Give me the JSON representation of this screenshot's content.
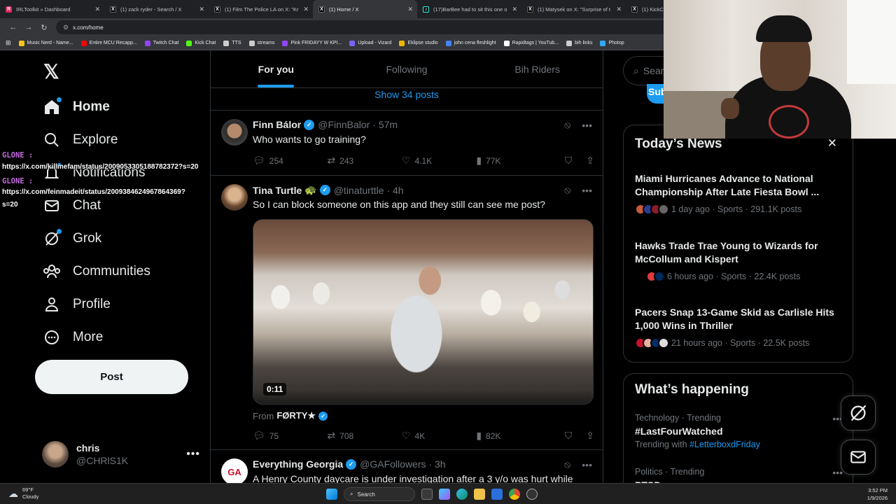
{
  "browser": {
    "tabs": [
      {
        "title": "IRLToolkit » Dashboard",
        "icon": "irltoolkit-icon",
        "active": false
      },
      {
        "title": "(1) zack ryder - Search / X",
        "icon": "x-icon",
        "active": false
      },
      {
        "title": "(1) Film The Police LA on X: \"Kr",
        "icon": "x-icon",
        "active": false
      },
      {
        "title": "(1) Home / X",
        "icon": "x-icon",
        "active": true
      },
      {
        "title": "(17)BarBee had to sit this one o",
        "icon": "tiktok-icon",
        "active": false
      },
      {
        "title": "(1) Matysek on X: \"Surprise of t",
        "icon": "x-icon",
        "active": false
      },
      {
        "title": "(1) KickC",
        "icon": "x-icon",
        "active": false
      }
    ],
    "url": "x.com/home",
    "bookmarks": [
      {
        "label": "Music Nerd - Name...",
        "color": "#f5c518"
      },
      {
        "label": "Entire MCU Recapp...",
        "color": "#ff0000"
      },
      {
        "label": "Twitch Chat",
        "color": "#9146ff"
      },
      {
        "label": "Kick Chat",
        "color": "#53fc18"
      },
      {
        "label": "TTS",
        "color": "#cccccc"
      },
      {
        "label": "streams",
        "color": "#cccccc"
      },
      {
        "label": "Pink FRIDAYY W KPI...",
        "color": "#9146ff"
      },
      {
        "label": "Upload - Vizard",
        "color": "#7b61ff"
      },
      {
        "label": "Eklipse studio",
        "color": "#f0b400"
      },
      {
        "label": "john cena fleshlight",
        "color": "#4285f4"
      },
      {
        "label": "Rapidtags | YouTub...",
        "color": "#ffffff"
      },
      {
        "label": "bih links",
        "color": "#cccccc"
      },
      {
        "label": "Photop",
        "color": "#31a8ff"
      }
    ]
  },
  "nav": {
    "items": [
      {
        "label": "Home",
        "icon": "home-icon"
      },
      {
        "label": "Explore",
        "icon": "search-icon"
      },
      {
        "label": "Notifications",
        "icon": "bell-icon"
      },
      {
        "label": "Chat",
        "icon": "mail-icon"
      },
      {
        "label": "Grok",
        "icon": "grok-icon"
      },
      {
        "label": "Communities",
        "icon": "communities-icon"
      },
      {
        "label": "Profile",
        "icon": "profile-icon"
      },
      {
        "label": "More",
        "icon": "more-circle-icon"
      }
    ],
    "post_label": "Post",
    "user": {
      "name": "chris",
      "handle": "@CHRlS1K"
    }
  },
  "chat_overlay": [
    {
      "name": "GLONE",
      "msg": "https://x.com/killmefam/status/2009053305188782372?s=20"
    },
    {
      "name": "GLONE",
      "msg_line1": "https://x.com/feinmadeit/status/2009384624967864369?",
      "msg_line2": "s=20"
    }
  ],
  "feed": {
    "tabs": [
      "For you",
      "Following",
      "Bih Riders"
    ],
    "show_posts": "Show 34 posts",
    "tweets": [
      {
        "name": "Finn Bálor",
        "handle": "@FinnBalor",
        "time": "57m",
        "text": "Who wants to go training?",
        "replies": "254",
        "reposts": "243",
        "likes": "4.1K",
        "views": "77K"
      },
      {
        "name": "Tina Turtle",
        "emoji": "🐢",
        "handle": "@tinaturttle",
        "time": "4h",
        "text": "So I can block someone on this app and they still can see me post?",
        "video_time": "0:11",
        "from_label": "From",
        "from_name": "FØRTY★",
        "replies": "75",
        "reposts": "708",
        "likes": "4K",
        "views": "82K"
      },
      {
        "name": "Everything Georgia",
        "handle": "@GAFollowers",
        "time": "3h",
        "text": "A Henry County daycare is under investigation after a 3 y/o was hurt while"
      }
    ]
  },
  "right": {
    "search_placeholder": "Sear",
    "subscribe_label": "Sub",
    "news_title": "Today’s News",
    "news": [
      {
        "headline": "Miami Hurricanes Advance to National Championship After Late Fiesta Bowl ...",
        "meta": "1 day ago · Sports · 291.1K posts"
      },
      {
        "headline": "Hawks Trade Trae Young to Wizards for McCollum and Kispert",
        "meta": "6 hours ago · Sports · 22.4K posts"
      },
      {
        "headline": "Pacers Snap 13-Game Skid as Carlisle Hits 1,000 Wins in Thriller",
        "meta": "21 hours ago · Sports · 22.5K posts"
      }
    ],
    "happening_title": "What’s happening",
    "trends": [
      {
        "category": "Technology · Trending",
        "title": "#LastFourWatched",
        "with_label": "Trending with",
        "with_tag": "#LetterboxdFriday"
      },
      {
        "category": "Politics · Trending",
        "title": "PTSD"
      }
    ]
  },
  "taskbar": {
    "weather_temp": "69°F",
    "weather_desc": "Cloudy",
    "search_label": "Search",
    "time": "3:52 PM",
    "date": "1/9/2026"
  },
  "colors": {
    "accent": "#1d9bf0",
    "background": "#000000",
    "border": "#2f3336",
    "muted": "#71767b"
  }
}
